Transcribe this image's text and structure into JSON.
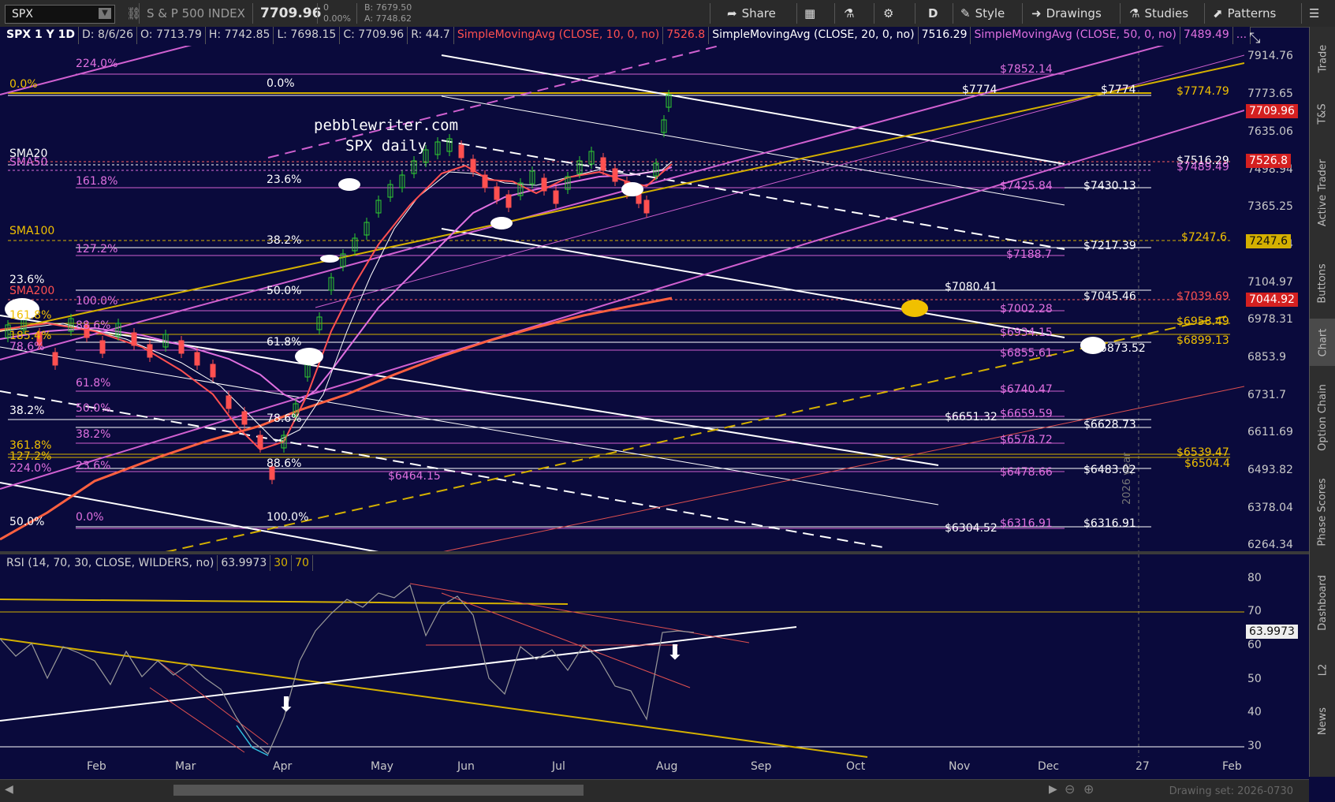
{
  "toolbar": {
    "symbol": "SPX",
    "name": "S & P 500 INDEX",
    "last": "7709.96",
    "change": "0",
    "change_pct": "0.00%",
    "bid": "B: 7679.50",
    "ask": "A: 7748.62",
    "share": "Share",
    "interval": "D",
    "style": "Style",
    "drawings": "Drawings",
    "studies": "Studies",
    "patterns": "Patterns"
  },
  "info": {
    "title": "SPX 1 Y 1D",
    "date": "D: 8/6/26",
    "open": "O: 7713.79",
    "high": "H: 7742.85",
    "low": "L: 7698.15",
    "close": "C: 7709.96",
    "range": "R: 44.7",
    "sma10": "SimpleMovingAvg (CLOSE, 10, 0, no)",
    "sma10_val": "7526.8",
    "sma20": "SimpleMovingAvg (CLOSE, 20, 0, no)",
    "sma20_val": "7516.29",
    "sma50": "SimpleMovingAvg (CLOSE, 50, 0, no)",
    "sma50_val": "7489.49",
    "more": "..."
  },
  "watermark": {
    "line1": "pebblewriter.com",
    "line2": "SPX daily"
  },
  "price_axis": [
    "7914.76",
    "7773.65",
    "7635.06",
    "7498.94",
    "7365.25",
    "7233.54",
    "7104.97",
    "6978.31",
    "6853.9",
    "6731.7",
    "6611.69",
    "6493.82",
    "6378.04",
    "6264.34"
  ],
  "price_tags": [
    {
      "value": "7709.96",
      "color": "#d42020"
    },
    {
      "value": "7526.8",
      "color": "#d42020"
    },
    {
      "value": "7247.6",
      "color": "#d4b000"
    },
    {
      "value": "7044.92",
      "color": "#d42020"
    }
  ],
  "price_labels": [
    {
      "text": "$7852.14",
      "color": "#e070e0"
    },
    {
      "text": "$7774",
      "color": "#ffffff"
    },
    {
      "text": "$7774",
      "color": "#ffffff"
    },
    {
      "text": "$7774.79",
      "color": "#f0c000"
    },
    {
      "text": "$7516.29",
      "color": "#ffffff"
    },
    {
      "text": "$7489.49",
      "color": "#e070e0"
    },
    {
      "text": "$7425.84",
      "color": "#e070e0"
    },
    {
      "text": "$7430.13",
      "color": "#ffffff"
    },
    {
      "text": "$7247.6",
      "color": "#f0c000"
    },
    {
      "text": "$7217.39",
      "color": "#ffffff"
    },
    {
      "text": "$7188.7",
      "color": "#e070e0"
    },
    {
      "text": "$7080.41",
      "color": "#ffffff"
    },
    {
      "text": "$7045.46",
      "color": "#ffffff"
    },
    {
      "text": "$7039.69",
      "color": "#ff5050"
    },
    {
      "text": "$7002.28",
      "color": "#e070e0"
    },
    {
      "text": "$6958.49",
      "color": "#f0c000"
    },
    {
      "text": "$6934.15",
      "color": "#e070e0"
    },
    {
      "text": "$6899.13",
      "color": "#f0c000"
    },
    {
      "text": "$6873.52",
      "color": "#ffffff"
    },
    {
      "text": "$6855.61",
      "color": "#e070e0"
    },
    {
      "text": "$6740.47",
      "color": "#e070e0"
    },
    {
      "text": "$6651.32",
      "color": "#ffffff"
    },
    {
      "text": "$6659.59",
      "color": "#e070e0"
    },
    {
      "text": "$6628.73",
      "color": "#ffffff"
    },
    {
      "text": "$6578.72",
      "color": "#e070e0"
    },
    {
      "text": "$6539.47",
      "color": "#f0c000"
    },
    {
      "text": "$6504.4",
      "color": "#f0c000"
    },
    {
      "text": "$6483.02",
      "color": "#ffffff"
    },
    {
      "text": "$6478.66",
      "color": "#e070e0"
    },
    {
      "text": "$6464.15",
      "color": "#e070e0"
    },
    {
      "text": "$6304.52",
      "color": "#ffffff"
    },
    {
      "text": "$6316.91",
      "color": "#e070e0"
    },
    {
      "text": "$6316.91",
      "color": "#ffffff"
    }
  ],
  "fib_labels": [
    {
      "text": "224.0%",
      "color": "#e070e0"
    },
    {
      "text": "0.0%",
      "color": "#ffffff"
    },
    {
      "text": "0.0%",
      "color": "#f0c000"
    },
    {
      "text": "SMA20",
      "color": "#ffffff"
    },
    {
      "text": "SMA50",
      "color": "#e070e0"
    },
    {
      "text": "161.8%",
      "color": "#e070e0"
    },
    {
      "text": "23.6%",
      "color": "#ffffff"
    },
    {
      "text": "SMA100",
      "color": "#f0c000"
    },
    {
      "text": "38.2%",
      "color": "#ffffff"
    },
    {
      "text": "127.2%",
      "color": "#e070e0"
    },
    {
      "text": "23.6%",
      "color": "#ffffff"
    },
    {
      "text": "SMA200",
      "color": "#ff5050"
    },
    {
      "text": "50.0%",
      "color": "#ffffff"
    },
    {
      "text": "100.0%",
      "color": "#e070e0"
    },
    {
      "text": "161.8%",
      "color": "#f0c000"
    },
    {
      "text": "88.6%",
      "color": "#e070e0"
    },
    {
      "text": "185.4%",
      "color": "#f0c000"
    },
    {
      "text": "61.8%",
      "color": "#ffffff"
    },
    {
      "text": "78.6%",
      "color": "#e070e0"
    },
    {
      "text": "61.8%",
      "color": "#e070e0"
    },
    {
      "text": "38.2%",
      "color": "#ffffff"
    },
    {
      "text": "50.0%",
      "color": "#e070e0"
    },
    {
      "text": "78.6%",
      "color": "#ffffff"
    },
    {
      "text": "38.2%",
      "color": "#e070e0"
    },
    {
      "text": "361.8%",
      "color": "#f0c000"
    },
    {
      "text": "127.2%",
      "color": "#f0c000"
    },
    {
      "text": "224.0%",
      "color": "#e070e0"
    },
    {
      "text": "23.6%",
      "color": "#e070e0"
    },
    {
      "text": "88.6%",
      "color": "#ffffff"
    },
    {
      "text": "50.0%",
      "color": "#ffffff"
    },
    {
      "text": "0.0%",
      "color": "#e070e0"
    },
    {
      "text": "100.0%",
      "color": "#ffffff"
    }
  ],
  "rsi": {
    "label": "RSI (14, 70, 30, CLOSE, WILDERS, no)",
    "value": "63.9973",
    "ob": "30",
    "os": "70",
    "axis": [
      "80",
      "70",
      "60",
      "50",
      "40",
      "30"
    ]
  },
  "months": [
    "Feb",
    "Mar",
    "Apr",
    "May",
    "Jun",
    "Jul",
    "Aug",
    "Sep",
    "Oct",
    "Nov",
    "Dec",
    "27",
    "Feb"
  ],
  "vertical_label": "2026 year",
  "right_tabs": [
    "Trade",
    "T&S",
    "Active Trader",
    "Buttons",
    "Chart",
    "Option Chain",
    "Phase Scores",
    "Dashboard",
    "L2",
    "News"
  ],
  "drawing_set": "Drawing set: 2026-0730"
}
